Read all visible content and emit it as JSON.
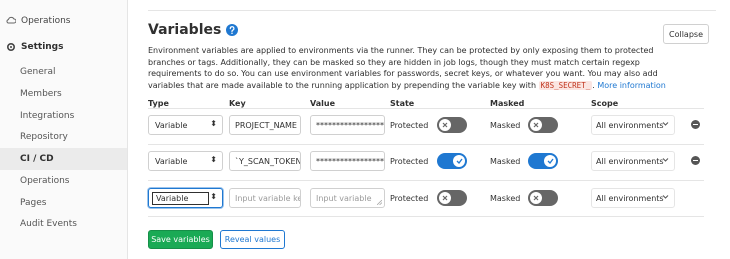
{
  "sidebar": {
    "operations_top": "Operations",
    "settings": "Settings",
    "items": [
      "General",
      "Members",
      "Integrations",
      "Repository",
      "CI / CD",
      "Operations",
      "Pages",
      "Audit Events"
    ],
    "active_index": 4
  },
  "section": {
    "title": "Variables",
    "collapse_label": "Collapse",
    "description_pre": "Environment variables are applied to environments via the runner. They can be protected by only exposing them to protected branches or tags. Additionally, they can be masked so they are hidden in job logs, though they must match certain regexp requirements to do so. You can use environment variables for passwords, secret keys, or whatever you want. You may also add variables that are made available to the running application by prepending the variable key with ",
    "description_code": "K8S_SECRET_",
    "description_post": ".",
    "more_info_link": "More information"
  },
  "columns": {
    "type": "Type",
    "key": "Key",
    "value": "Value",
    "state": "State",
    "masked": "Masked",
    "scope": "Scope"
  },
  "rows": [
    {
      "type": "Variable",
      "key": "PROJECT_NAME",
      "value": "******************",
      "state_label": "Protected",
      "protected": false,
      "masked_label": "Masked",
      "masked": false,
      "scope": "All environments"
    },
    {
      "type": "Variable",
      "key": "`Y_SCAN_TOKEN",
      "value": "******************",
      "state_label": "Protected",
      "protected": true,
      "masked_label": "Masked",
      "masked": true,
      "scope": "All environments"
    },
    {
      "type": "Variable",
      "key_placeholder": "Input variable ke",
      "value_placeholder": "Input variable",
      "state_label": "Protected",
      "protected": false,
      "masked_label": "Masked",
      "masked": false,
      "scope": "All environments"
    }
  ],
  "actions": {
    "save": "Save variables",
    "reveal": "Reveal values"
  },
  "colors": {
    "accent_blue": "#1f78d1",
    "save_green": "#1aaa55",
    "toggle_off": "#666666",
    "code_red": "#c0341d"
  }
}
